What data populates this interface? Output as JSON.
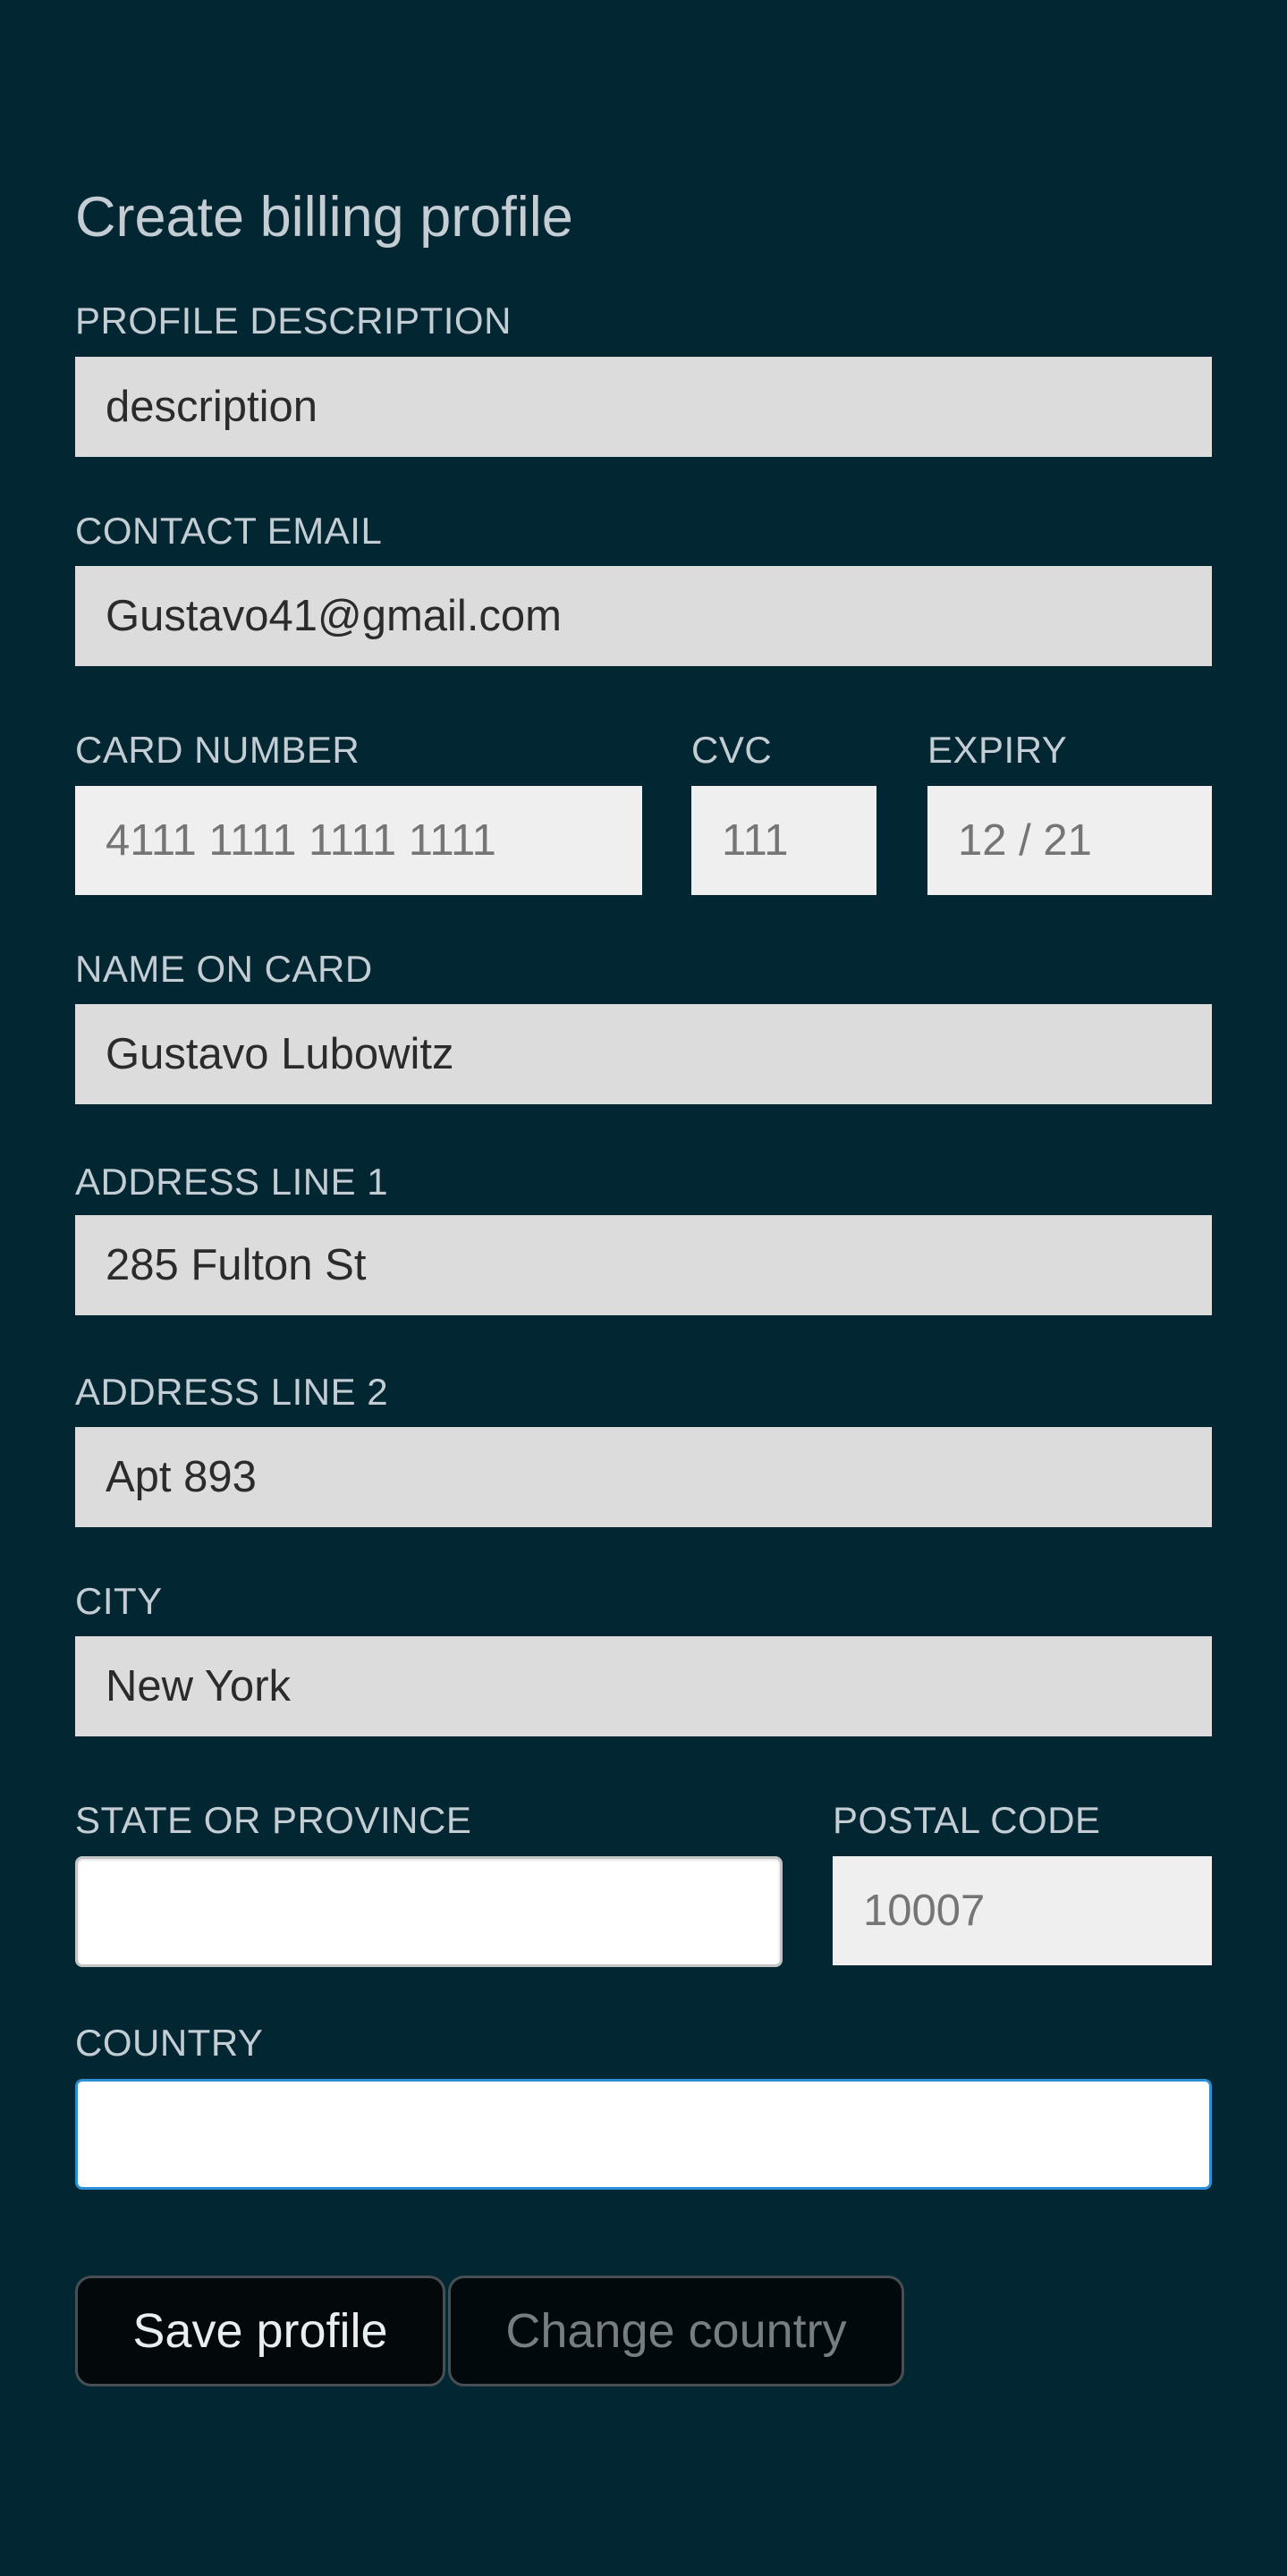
{
  "form": {
    "title": "Create billing profile",
    "profile_description": {
      "label": "PROFILE DESCRIPTION",
      "value": "description"
    },
    "contact_email": {
      "label": "CONTACT EMAIL",
      "value": "Gustavo41@gmail.com"
    },
    "card_number": {
      "label": "CARD NUMBER",
      "placeholder": "4111 1111 1111 1111"
    },
    "cvc": {
      "label": "CVC",
      "placeholder": "111"
    },
    "expiry": {
      "label": "EXPIRY",
      "placeholder": "12 / 21"
    },
    "name_on_card": {
      "label": "NAME ON CARD",
      "value": "Gustavo Lubowitz"
    },
    "address_line_1": {
      "label": "ADDRESS LINE 1",
      "value": "285 Fulton St"
    },
    "address_line_2": {
      "label": "ADDRESS LINE 2",
      "value": "Apt 893"
    },
    "city": {
      "label": "CITY",
      "value": "New York"
    },
    "state_or_province": {
      "label": "STATE OR PROVINCE",
      "value": ""
    },
    "postal_code": {
      "label": "POSTAL CODE",
      "placeholder": "10007"
    },
    "country": {
      "label": "COUNTRY",
      "value": ""
    }
  },
  "actions": {
    "save_label": "Save profile",
    "change_country_label": "Change country"
  }
}
